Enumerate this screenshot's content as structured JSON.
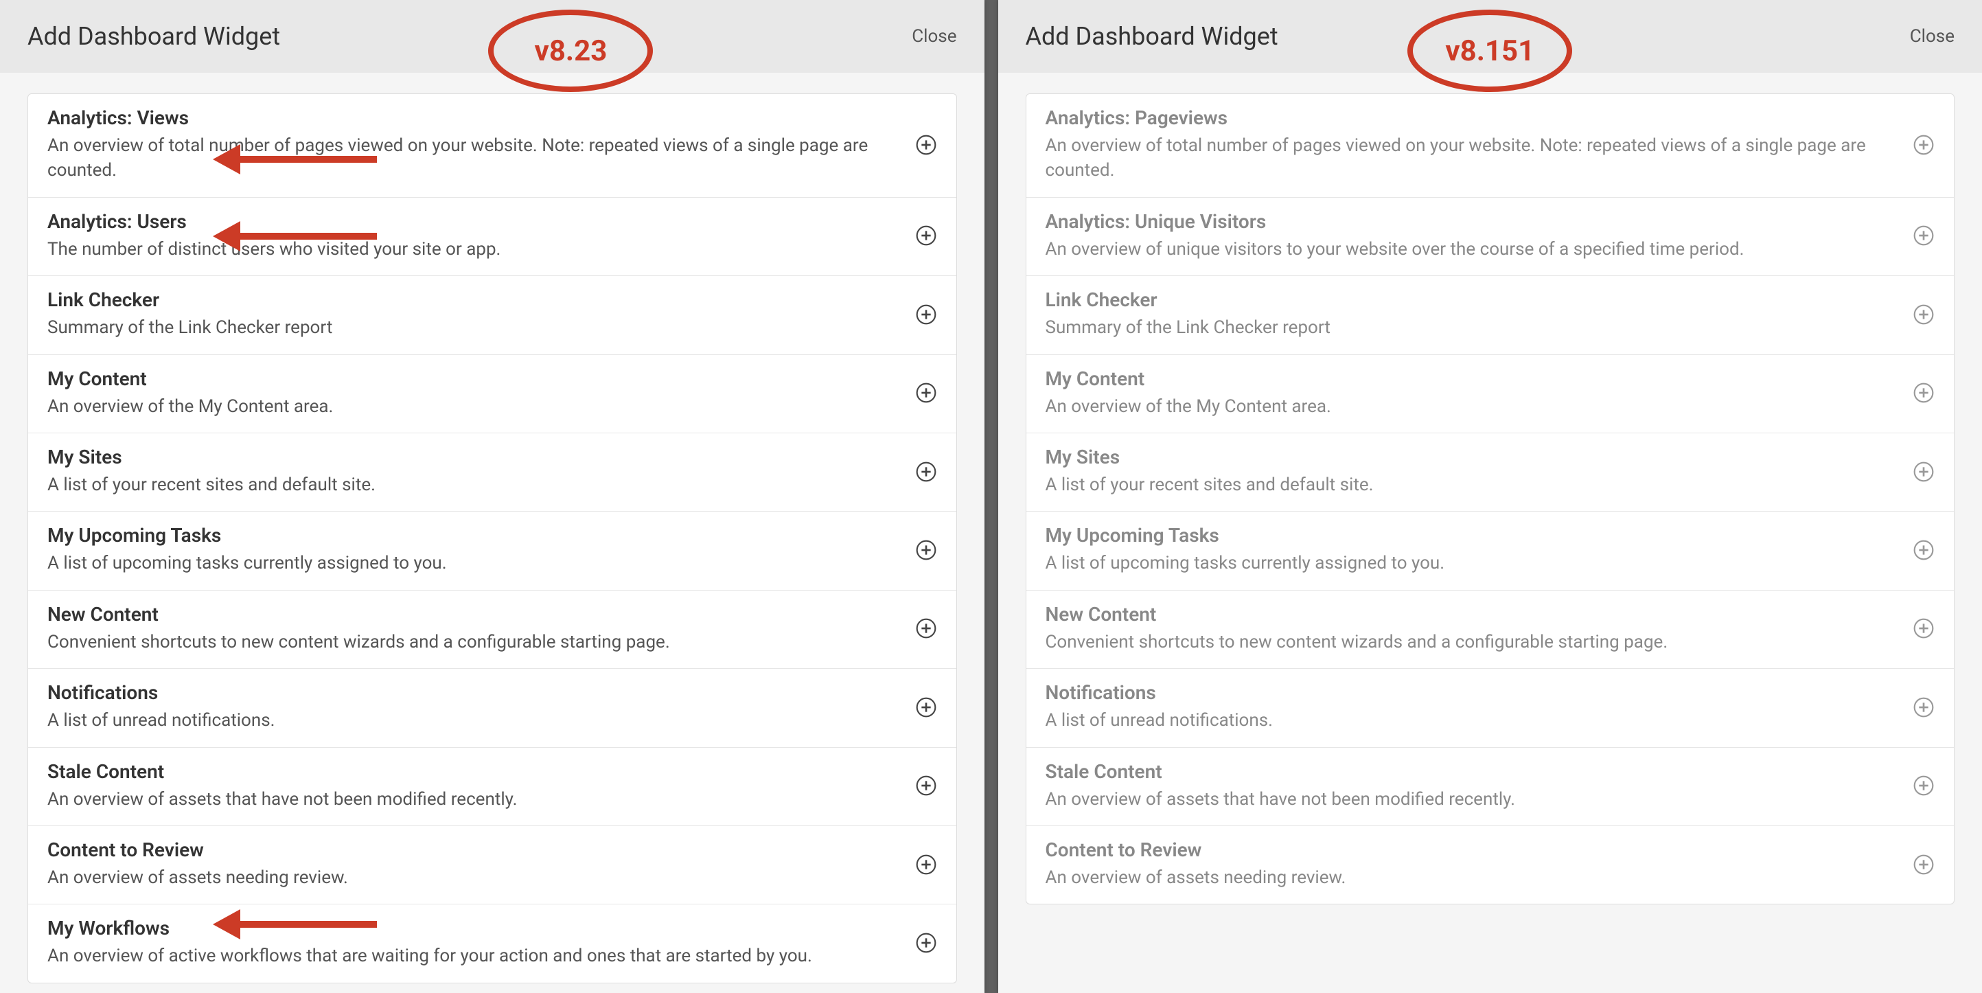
{
  "annotations": {
    "left_badge": "v8.23",
    "right_badge": "v8.151"
  },
  "left_panel": {
    "title": "Add Dashboard Widget",
    "close": "Close",
    "widgets": [
      {
        "title": "Analytics: Views",
        "desc": "An overview of total number of pages viewed on your website. Note: repeated views of a single page are counted."
      },
      {
        "title": "Analytics: Users",
        "desc": "The number of distinct users who visited your site or app."
      },
      {
        "title": "Link Checker",
        "desc": "Summary of the Link Checker report"
      },
      {
        "title": "My Content",
        "desc": "An overview of the My Content area."
      },
      {
        "title": "My Sites",
        "desc": "A list of your recent sites and default site."
      },
      {
        "title": "My Upcoming Tasks",
        "desc": "A list of upcoming tasks currently assigned to you."
      },
      {
        "title": "New Content",
        "desc": "Convenient shortcuts to new content wizards and a configurable starting page."
      },
      {
        "title": "Notifications",
        "desc": "A list of unread notifications."
      },
      {
        "title": "Stale Content",
        "desc": "An overview of assets that have not been modified recently."
      },
      {
        "title": "Content to Review",
        "desc": "An overview of assets needing review."
      },
      {
        "title": "My Workflows",
        "desc": "An overview of active workflows that are waiting for your action and ones that are started by you."
      }
    ]
  },
  "right_panel": {
    "title": "Add Dashboard Widget",
    "close": "Close",
    "widgets": [
      {
        "title": "Analytics: Pageviews",
        "desc": "An overview of total number of pages viewed on your website. Note: repeated views of a single page are counted."
      },
      {
        "title": "Analytics: Unique Visitors",
        "desc": "An overview of unique visitors to your website over the course of a specified time period."
      },
      {
        "title": "Link Checker",
        "desc": "Summary of the Link Checker report"
      },
      {
        "title": "My Content",
        "desc": "An overview of the My Content area."
      },
      {
        "title": "My Sites",
        "desc": "A list of your recent sites and default site."
      },
      {
        "title": "My Upcoming Tasks",
        "desc": "A list of upcoming tasks currently assigned to you."
      },
      {
        "title": "New Content",
        "desc": "Convenient shortcuts to new content wizards and a configurable starting page."
      },
      {
        "title": "Notifications",
        "desc": "A list of unread notifications."
      },
      {
        "title": "Stale Content",
        "desc": "An overview of assets that have not been modified recently."
      },
      {
        "title": "Content to Review",
        "desc": "An overview of assets needing review."
      }
    ]
  }
}
